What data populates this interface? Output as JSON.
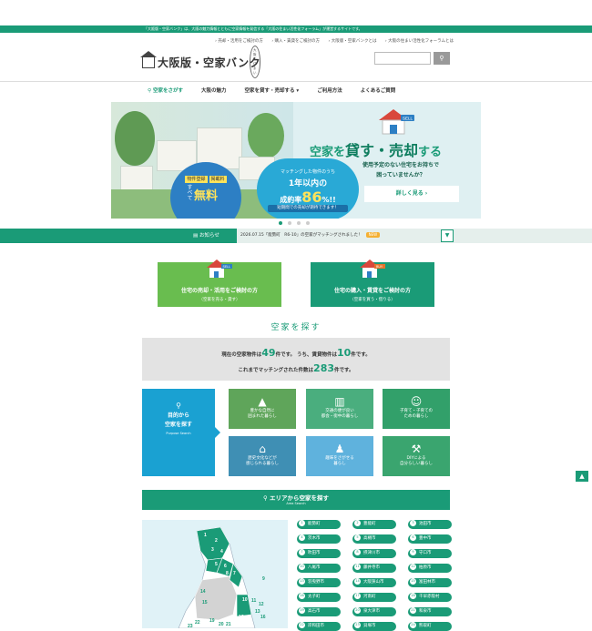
{
  "topbar": {
    "text": "「大阪版・空家バンク」は、大阪の魅力情報とともに空家情報を発信する「大阪の住まい活性化フォーラム」が運営するサイトです。"
  },
  "toplinks": [
    "売却・活用をご検討の方",
    "購入・賃貸をご検討の方",
    "大阪版・空家バンクとは",
    "大阪の住まい活性化フォーラムとは"
  ],
  "logo": {
    "text": "大阪版・空家バンク",
    "badge": "大阪の住まい"
  },
  "search": {
    "placeholder": "",
    "icon": "search-icon"
  },
  "nav": [
    "空家をさがす",
    "大阪の魅力",
    "空家を貸す・売却する",
    "ご利用方法",
    "よくあるご質問"
  ],
  "hero": {
    "heading_a": "空家を",
    "heading_b": "貸す・売却",
    "heading_c": "する",
    "sub1": "使用予定のない住宅をお持ちで",
    "sub2": "困っていませんか？",
    "button": "詳しく見る ›",
    "sell_tag": "SELL",
    "circle_tag1": "物件登録",
    "circle_tag2": "掲載料",
    "circle_vertical": "すべて",
    "circle_big": "無料",
    "pill1": "マッチングした物件のうち",
    "pill2": "1年以内の",
    "pill3a": "成約率",
    "pill3b": "86",
    "pill3c": "%!!",
    "pill4": "短期間での売却が期待できます！"
  },
  "news": {
    "label": "お知らせ",
    "text": "2026.07.15「能勢町　R6-10」の空家がマッチングされました！",
    "badge": "NEW"
  },
  "cta": [
    {
      "tag": "SELL",
      "line1": "住宅の売却・活用をご検討の方",
      "line2": "（空家を売る・貸す）",
      "color": "#69bd4f"
    },
    {
      "tag": "BUY",
      "line1": "住宅の購入・賃貸をご検討の方",
      "line2": "（空家を買う・借りる）",
      "color": "#1a9b77"
    }
  ],
  "section_title": "空家を探す",
  "stats": {
    "r1a": "現在の空家物件は",
    "total": "49",
    "r1b": "件です。 うち、賃貸物件は",
    "rental": "10",
    "r1c": "件です。",
    "r2a": "これまでマッチングされた件数は",
    "matched": "283",
    "r2b": "件です。"
  },
  "purpose": {
    "title1": "目的から",
    "title2": "空家を探す",
    "english": "Purpose Search"
  },
  "tiles": [
    {
      "icon": "tree-icon",
      "glyph": "▲",
      "l1": "豊かな自然に",
      "l2": "囲まれた暮らし"
    },
    {
      "icon": "building-icon",
      "glyph": "▥",
      "l1": "交通の便が良い",
      "l2": "都会・街中の暮らし"
    },
    {
      "icon": "child-icon",
      "glyph": "☺",
      "l1": "子育て・子育ての",
      "l2": "ための暮らし"
    },
    {
      "icon": "castle-icon",
      "glyph": "⌂",
      "l1": "歴史文化などが",
      "l2": "感じられる暮らし"
    },
    {
      "icon": "family-icon",
      "glyph": "♟",
      "l1": "趣味をさがせる",
      "l2": "暮らし"
    },
    {
      "icon": "drill-icon",
      "glyph": "⚒",
      "l1": "DIYによる",
      "l2": "自分らしい暮らし"
    }
  ],
  "area": {
    "title": "エリアから空家を探す",
    "english": "Area Search"
  },
  "map_numbers": [
    "1",
    "2",
    "3",
    "4",
    "5",
    "6",
    "7",
    "8",
    "9",
    "10",
    "11",
    "12",
    "13",
    "14",
    "15",
    "16",
    "17",
    "18",
    "19",
    "20",
    "21",
    "22",
    "23"
  ],
  "cities": [
    {
      "n": "1",
      "name": "能勢町"
    },
    {
      "n": "2",
      "name": "豊能町"
    },
    {
      "n": "3",
      "name": "池田市"
    },
    {
      "n": "4",
      "name": "茨木市"
    },
    {
      "n": "5",
      "name": "高槻市"
    },
    {
      "n": "6",
      "name": "豊中市"
    },
    {
      "n": "7",
      "name": "吹田市"
    },
    {
      "n": "8",
      "name": "摂津川市"
    },
    {
      "n": "9",
      "name": "守口市"
    },
    {
      "n": "10",
      "name": "八尾市"
    },
    {
      "n": "11",
      "name": "藤井寺市"
    },
    {
      "n": "12",
      "name": "柏原市"
    },
    {
      "n": "13",
      "name": "羽曳野市"
    },
    {
      "n": "14",
      "name": "大阪狭山市"
    },
    {
      "n": "15",
      "name": "富田林市"
    },
    {
      "n": "16",
      "name": "太子町"
    },
    {
      "n": "17",
      "name": "河南町"
    },
    {
      "n": "18",
      "name": "千早赤阪村"
    },
    {
      "n": "19",
      "name": "高石市"
    },
    {
      "n": "20",
      "name": "泉大津市"
    },
    {
      "n": "21",
      "name": "和泉市"
    },
    {
      "n": "22",
      "name": "岸和田市"
    },
    {
      "n": "23",
      "name": "貝塚市"
    },
    {
      "n": "24",
      "name": "熊取町"
    }
  ],
  "colors": {
    "brand": "#1a9b77",
    "accent_blue": "#1aa1d2",
    "yellow": "#ffe35a"
  }
}
